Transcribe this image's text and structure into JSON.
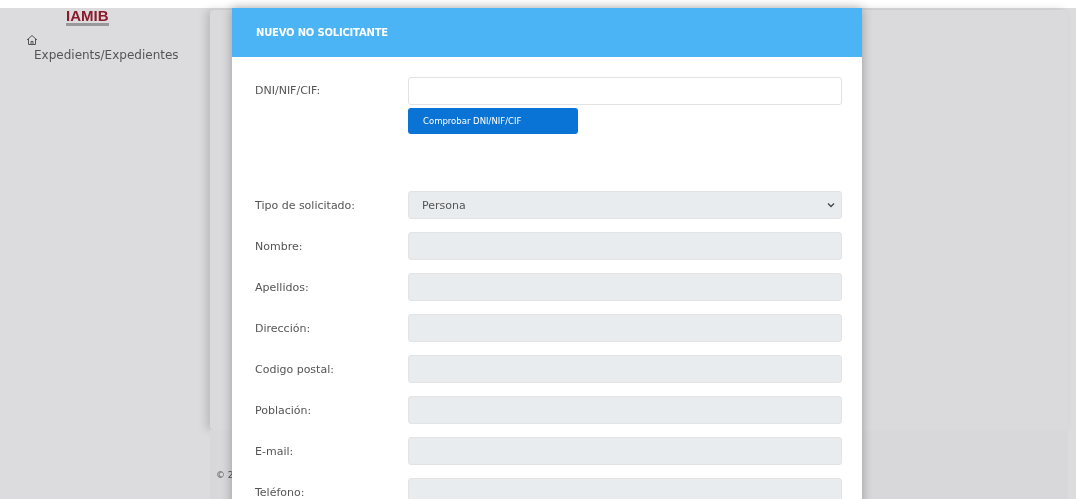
{
  "sidebar": {
    "logo": "IAMIB",
    "items": [
      {
        "label": "Expedients/Expedientes",
        "selected": false
      }
    ]
  },
  "footer": {
    "text": "© 2"
  },
  "modal": {
    "title": "NUEVO NO SOLICITANTE",
    "lookup": {
      "label": "DNI/NIF/CIF:",
      "disabled": false,
      "button": "Comprobar DNI/NIF/CIF"
    },
    "fields": [
      {
        "label": "Tipo de solicitado:",
        "kind": "select",
        "value": "Persona",
        "disabled": true
      },
      {
        "label": "Nombre:",
        "kind": "text",
        "disabled": true
      },
      {
        "label": "Apellidos:",
        "kind": "text",
        "disabled": true
      },
      {
        "label": "Dirección:",
        "kind": "text",
        "disabled": true
      },
      {
        "label": "Codigo postal:",
        "kind": "text",
        "disabled": true
      },
      {
        "label": "Población:",
        "kind": "text",
        "disabled": true
      },
      {
        "label": "E-mail:",
        "kind": "text",
        "disabled": true
      },
      {
        "label": "Teléfono:",
        "kind": "text",
        "disabled": true
      }
    ]
  }
}
